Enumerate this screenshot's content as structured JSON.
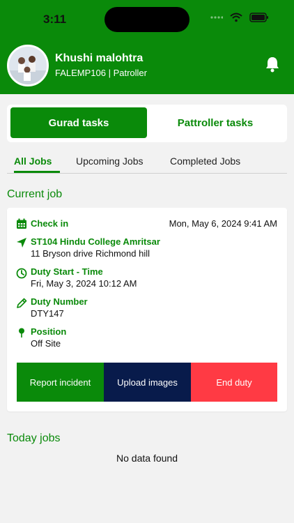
{
  "status_bar": {
    "time": "3:11"
  },
  "header": {
    "name": "Khushi malohtra",
    "subtitle": "FALEMP106 | Patroller"
  },
  "segment": {
    "active_label": "Gurad tasks",
    "inactive_label": "Pattroller tasks"
  },
  "tabs": [
    {
      "label": "All Jobs",
      "active": true
    },
    {
      "label": "Upcoming Jobs",
      "active": false
    },
    {
      "label": "Completed Jobs",
      "active": false
    }
  ],
  "current_job": {
    "section_title": "Current job",
    "check_in_label": "Check in",
    "check_in_value": "Mon, May 6, 2024 9:41 AM",
    "site_title": "ST104 Hindu College Amritsar",
    "site_address": "11 Bryson drive Richmond hill",
    "duty_start_label": "Duty Start - Time",
    "duty_start_value": "Fri, May 3, 2024 10:12 AM",
    "duty_number_label": "Duty Number",
    "duty_number_value": "DTY147",
    "position_label": "Position",
    "position_value": "Off Site",
    "actions": {
      "report": "Report incident",
      "upload": "Upload images",
      "end": "End duty"
    }
  },
  "today_jobs": {
    "section_title": "Today jobs",
    "empty_text": "No data found"
  },
  "colors": {
    "primary_green": "#0a8a0a",
    "navy": "#081b4b",
    "danger_red": "#ff3a44",
    "background": "#f2f2f2"
  },
  "icons": [
    "wifi-icon",
    "battery-icon",
    "bell-icon",
    "calendar-icon",
    "location-arrow-icon",
    "clock-icon",
    "pencil-icon",
    "pin-icon"
  ]
}
